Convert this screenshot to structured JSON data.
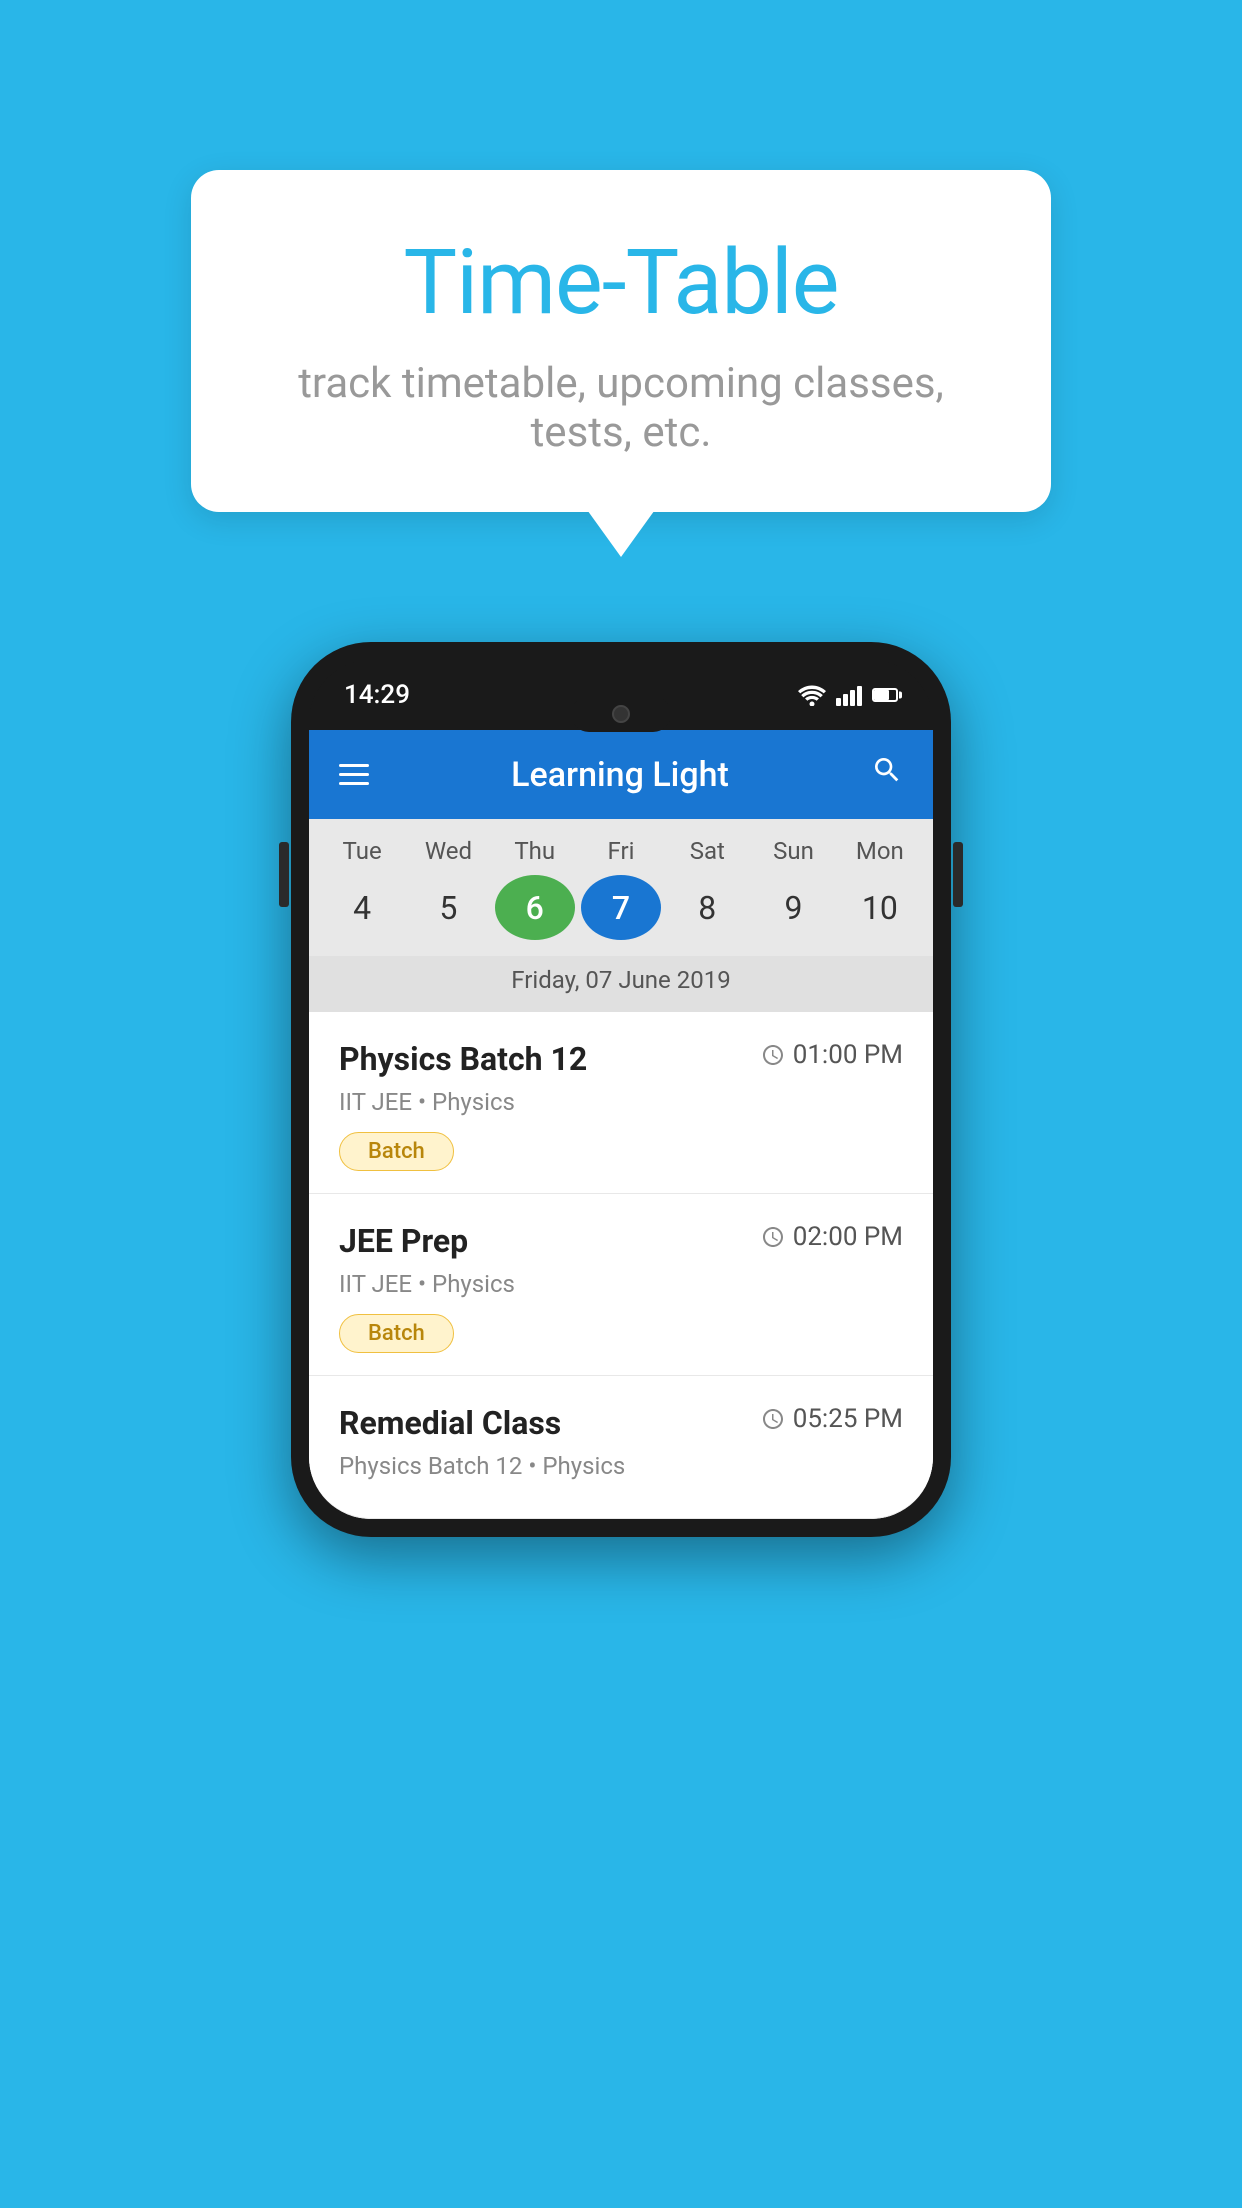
{
  "background_color": "#29B6E8",
  "tooltip": {
    "title": "Time-Table",
    "subtitle": "track timetable, upcoming classes, tests, etc."
  },
  "phone": {
    "status_time": "14:29",
    "app_name": "Learning Light",
    "calendar": {
      "days": [
        {
          "label": "Tue",
          "num": "4"
        },
        {
          "label": "Wed",
          "num": "5"
        },
        {
          "label": "Thu",
          "num": "6",
          "state": "today"
        },
        {
          "label": "Fri",
          "num": "7",
          "state": "selected"
        },
        {
          "label": "Sat",
          "num": "8"
        },
        {
          "label": "Sun",
          "num": "9"
        },
        {
          "label": "Mon",
          "num": "10"
        }
      ],
      "selected_date_label": "Friday, 07 June 2019"
    },
    "schedule": [
      {
        "name": "Physics Batch 12",
        "time": "01:00 PM",
        "meta": "IIT JEE • Physics",
        "tag": "Batch"
      },
      {
        "name": "JEE Prep",
        "time": "02:00 PM",
        "meta": "IIT JEE • Physics",
        "tag": "Batch"
      },
      {
        "name": "Remedial Class",
        "time": "05:25 PM",
        "meta": "Physics Batch 12 • Physics",
        "tag": null
      }
    ]
  }
}
